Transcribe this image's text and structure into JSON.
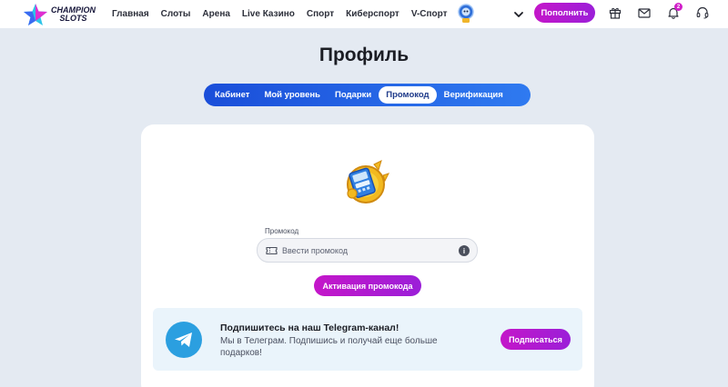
{
  "header": {
    "logo_line1": "CHAMPION",
    "logo_line2": "SLOTS",
    "nav": [
      "Главная",
      "Слоты",
      "Арена",
      "Live Казино",
      "Спорт",
      "Киберспорт",
      "V-Спорт"
    ],
    "deposit_label": "Пополнить",
    "notification_count": "2",
    "icons": [
      "gift-icon",
      "mail-icon",
      "bell-icon",
      "headset-icon"
    ]
  },
  "page": {
    "title": "Профиль"
  },
  "tabs": [
    {
      "label": "Кабинет",
      "active": false
    },
    {
      "label": "Мой уровень",
      "active": false
    },
    {
      "label": "Подарки",
      "active": false
    },
    {
      "label": "Промокод",
      "active": true
    },
    {
      "label": "Верификация",
      "active": false
    }
  ],
  "promo": {
    "label": "Промокод",
    "placeholder": "Ввести промокод",
    "value": "",
    "activate_label": "Активация промокода"
  },
  "telegram": {
    "title": "Подпишитесь на наш Telegram-канал!",
    "text": "Мы в Телеграм. Подпишись и получай еще больше подарков!",
    "button_label": "Подписаться"
  },
  "colors": {
    "accent_gradient_start": "#c416c9",
    "accent_gradient_end": "#9b1fd8",
    "tabs_start": "#1a4ed9",
    "tabs_end": "#2f7af0",
    "telegram_blue": "#2b9fe0",
    "page_bg": "#e4eaf2"
  }
}
